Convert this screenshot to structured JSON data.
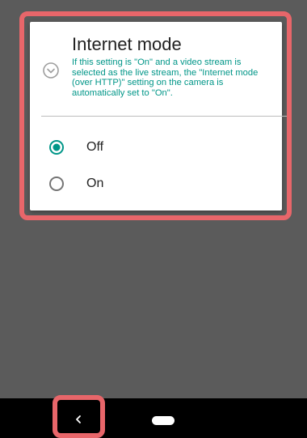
{
  "dialog": {
    "title": "Internet mode",
    "info_icon": "chevron-circle-down-icon",
    "description": "If this setting is \"On\" and a video stream is selected as the live stream, the \"Internet mode (over HTTP)\" setting on the camera is automatically set to \"On\".",
    "options": [
      {
        "label": "Off",
        "selected": true
      },
      {
        "label": "On",
        "selected": false
      }
    ]
  },
  "navbar": {
    "back_icon": "back-chevron-icon",
    "home_icon": "home-pill-icon"
  },
  "colors": {
    "accent": "#009688",
    "highlight": "#e8666a",
    "scrim": "#5b5b5b",
    "navbar": "#000000"
  }
}
